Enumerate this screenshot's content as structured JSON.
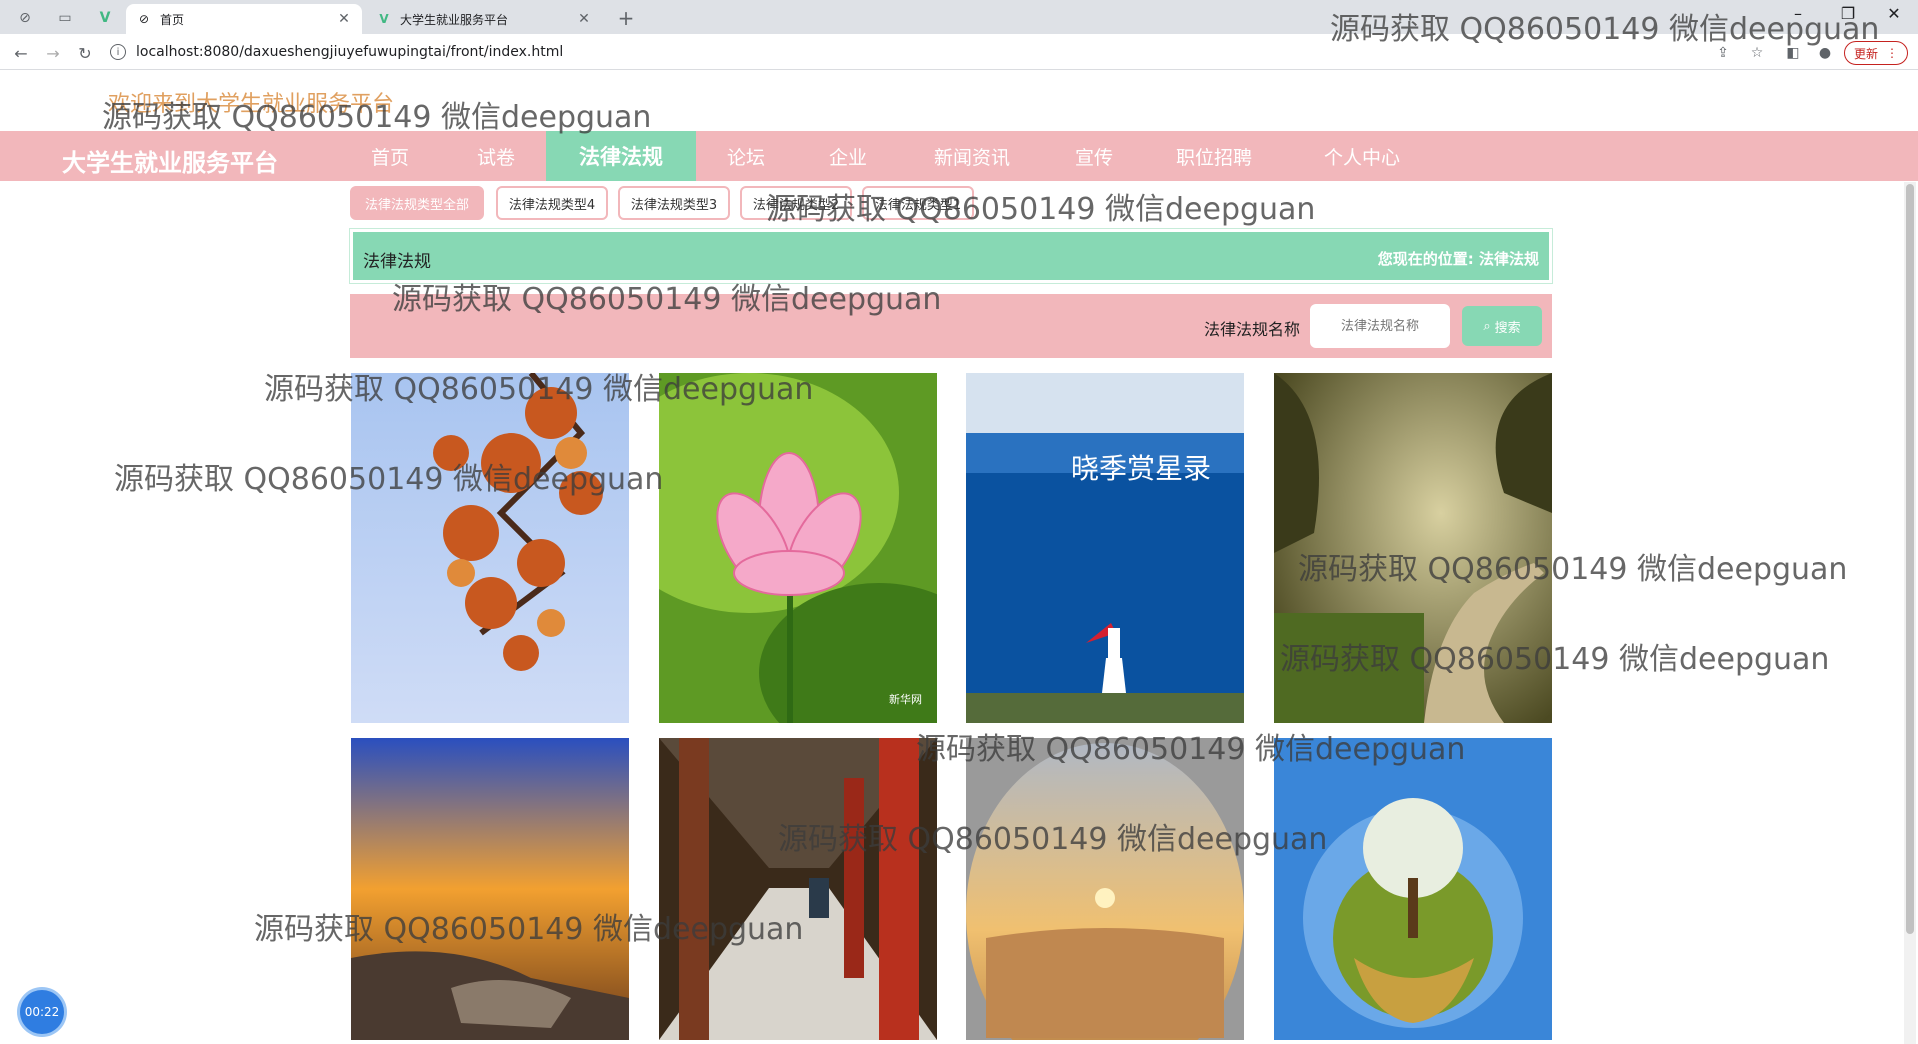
{
  "browser": {
    "tabs": [
      {
        "title": "首页",
        "active": true
      },
      {
        "title": "大学生就业服务平台",
        "active": false
      }
    ],
    "url": "localhost:8080/daxueshengjiuyefuwupingtai/front/index.html",
    "update_label": "更新"
  },
  "page": {
    "welcome": "欢迎来到大学生就业服务平台",
    "brand": "大学生就业服务平台",
    "nav": [
      {
        "label": "首页",
        "active": false
      },
      {
        "label": "试卷",
        "active": false
      },
      {
        "label": "法律法规",
        "active": true
      },
      {
        "label": "论坛",
        "active": false
      },
      {
        "label": "企业",
        "active": false
      },
      {
        "label": "新闻资讯",
        "active": false
      },
      {
        "label": "宣传",
        "active": false
      },
      {
        "label": "职位招聘",
        "active": false
      },
      {
        "label": "个人中心",
        "active": false
      }
    ],
    "filters": [
      {
        "label": "法律法规类型全部",
        "active": true
      },
      {
        "label": "法律法规类型4",
        "active": false
      },
      {
        "label": "法律法规类型3",
        "active": false
      },
      {
        "label": "法律法规类型2",
        "active": false
      },
      {
        "label": "法律法规类型1",
        "active": false
      }
    ],
    "crumb": {
      "title": "法律法规",
      "position_label": "您现在的位置:",
      "position_value": "法律法规"
    },
    "search": {
      "label": "法律法规名称",
      "placeholder": "法律法规名称",
      "button": "搜索"
    },
    "cards": [
      {
        "name": "autumn-leaves-image"
      },
      {
        "name": "lotus-flower-image",
        "caption": "新华网"
      },
      {
        "name": "sea-girl-image",
        "caption": "晓季赏星录"
      },
      {
        "name": "forest-path-image"
      },
      {
        "name": "sunset-beach-image"
      },
      {
        "name": "red-corridor-image"
      },
      {
        "name": "desert-sunset-image"
      },
      {
        "name": "planet-tree-image"
      }
    ],
    "timer": "00:22"
  },
  "watermark": "源码获取 QQ86050149 微信deepguan",
  "colors": {
    "pink": "#f2b7bb",
    "green": "#87d8b4",
    "welcome": "#e0a060"
  }
}
